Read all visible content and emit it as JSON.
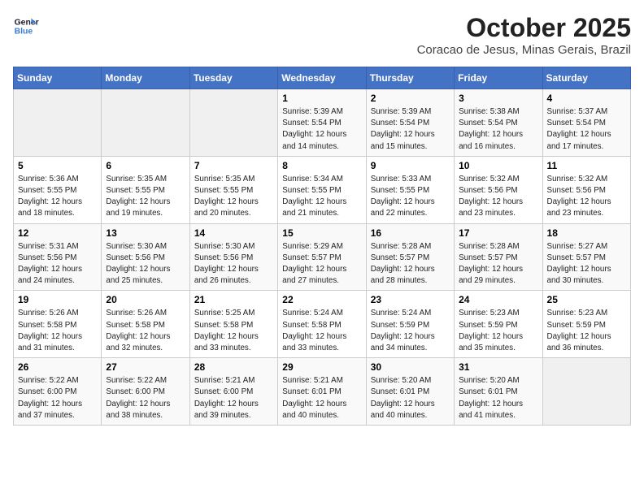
{
  "header": {
    "logo_line1": "General",
    "logo_line2": "Blue",
    "title": "October 2025",
    "subtitle": "Coracao de Jesus, Minas Gerais, Brazil"
  },
  "weekdays": [
    "Sunday",
    "Monday",
    "Tuesday",
    "Wednesday",
    "Thursday",
    "Friday",
    "Saturday"
  ],
  "weeks": [
    [
      {
        "day": "",
        "info": ""
      },
      {
        "day": "",
        "info": ""
      },
      {
        "day": "",
        "info": ""
      },
      {
        "day": "1",
        "info": "Sunrise: 5:39 AM\nSunset: 5:54 PM\nDaylight: 12 hours\nand 14 minutes."
      },
      {
        "day": "2",
        "info": "Sunrise: 5:39 AM\nSunset: 5:54 PM\nDaylight: 12 hours\nand 15 minutes."
      },
      {
        "day": "3",
        "info": "Sunrise: 5:38 AM\nSunset: 5:54 PM\nDaylight: 12 hours\nand 16 minutes."
      },
      {
        "day": "4",
        "info": "Sunrise: 5:37 AM\nSunset: 5:54 PM\nDaylight: 12 hours\nand 17 minutes."
      }
    ],
    [
      {
        "day": "5",
        "info": "Sunrise: 5:36 AM\nSunset: 5:55 PM\nDaylight: 12 hours\nand 18 minutes."
      },
      {
        "day": "6",
        "info": "Sunrise: 5:35 AM\nSunset: 5:55 PM\nDaylight: 12 hours\nand 19 minutes."
      },
      {
        "day": "7",
        "info": "Sunrise: 5:35 AM\nSunset: 5:55 PM\nDaylight: 12 hours\nand 20 minutes."
      },
      {
        "day": "8",
        "info": "Sunrise: 5:34 AM\nSunset: 5:55 PM\nDaylight: 12 hours\nand 21 minutes."
      },
      {
        "day": "9",
        "info": "Sunrise: 5:33 AM\nSunset: 5:55 PM\nDaylight: 12 hours\nand 22 minutes."
      },
      {
        "day": "10",
        "info": "Sunrise: 5:32 AM\nSunset: 5:56 PM\nDaylight: 12 hours\nand 23 minutes."
      },
      {
        "day": "11",
        "info": "Sunrise: 5:32 AM\nSunset: 5:56 PM\nDaylight: 12 hours\nand 23 minutes."
      }
    ],
    [
      {
        "day": "12",
        "info": "Sunrise: 5:31 AM\nSunset: 5:56 PM\nDaylight: 12 hours\nand 24 minutes."
      },
      {
        "day": "13",
        "info": "Sunrise: 5:30 AM\nSunset: 5:56 PM\nDaylight: 12 hours\nand 25 minutes."
      },
      {
        "day": "14",
        "info": "Sunrise: 5:30 AM\nSunset: 5:56 PM\nDaylight: 12 hours\nand 26 minutes."
      },
      {
        "day": "15",
        "info": "Sunrise: 5:29 AM\nSunset: 5:57 PM\nDaylight: 12 hours\nand 27 minutes."
      },
      {
        "day": "16",
        "info": "Sunrise: 5:28 AM\nSunset: 5:57 PM\nDaylight: 12 hours\nand 28 minutes."
      },
      {
        "day": "17",
        "info": "Sunrise: 5:28 AM\nSunset: 5:57 PM\nDaylight: 12 hours\nand 29 minutes."
      },
      {
        "day": "18",
        "info": "Sunrise: 5:27 AM\nSunset: 5:57 PM\nDaylight: 12 hours\nand 30 minutes."
      }
    ],
    [
      {
        "day": "19",
        "info": "Sunrise: 5:26 AM\nSunset: 5:58 PM\nDaylight: 12 hours\nand 31 minutes."
      },
      {
        "day": "20",
        "info": "Sunrise: 5:26 AM\nSunset: 5:58 PM\nDaylight: 12 hours\nand 32 minutes."
      },
      {
        "day": "21",
        "info": "Sunrise: 5:25 AM\nSunset: 5:58 PM\nDaylight: 12 hours\nand 33 minutes."
      },
      {
        "day": "22",
        "info": "Sunrise: 5:24 AM\nSunset: 5:58 PM\nDaylight: 12 hours\nand 33 minutes."
      },
      {
        "day": "23",
        "info": "Sunrise: 5:24 AM\nSunset: 5:59 PM\nDaylight: 12 hours\nand 34 minutes."
      },
      {
        "day": "24",
        "info": "Sunrise: 5:23 AM\nSunset: 5:59 PM\nDaylight: 12 hours\nand 35 minutes."
      },
      {
        "day": "25",
        "info": "Sunrise: 5:23 AM\nSunset: 5:59 PM\nDaylight: 12 hours\nand 36 minutes."
      }
    ],
    [
      {
        "day": "26",
        "info": "Sunrise: 5:22 AM\nSunset: 6:00 PM\nDaylight: 12 hours\nand 37 minutes."
      },
      {
        "day": "27",
        "info": "Sunrise: 5:22 AM\nSunset: 6:00 PM\nDaylight: 12 hours\nand 38 minutes."
      },
      {
        "day": "28",
        "info": "Sunrise: 5:21 AM\nSunset: 6:00 PM\nDaylight: 12 hours\nand 39 minutes."
      },
      {
        "day": "29",
        "info": "Sunrise: 5:21 AM\nSunset: 6:01 PM\nDaylight: 12 hours\nand 40 minutes."
      },
      {
        "day": "30",
        "info": "Sunrise: 5:20 AM\nSunset: 6:01 PM\nDaylight: 12 hours\nand 40 minutes."
      },
      {
        "day": "31",
        "info": "Sunrise: 5:20 AM\nSunset: 6:01 PM\nDaylight: 12 hours\nand 41 minutes."
      },
      {
        "day": "",
        "info": ""
      }
    ]
  ]
}
